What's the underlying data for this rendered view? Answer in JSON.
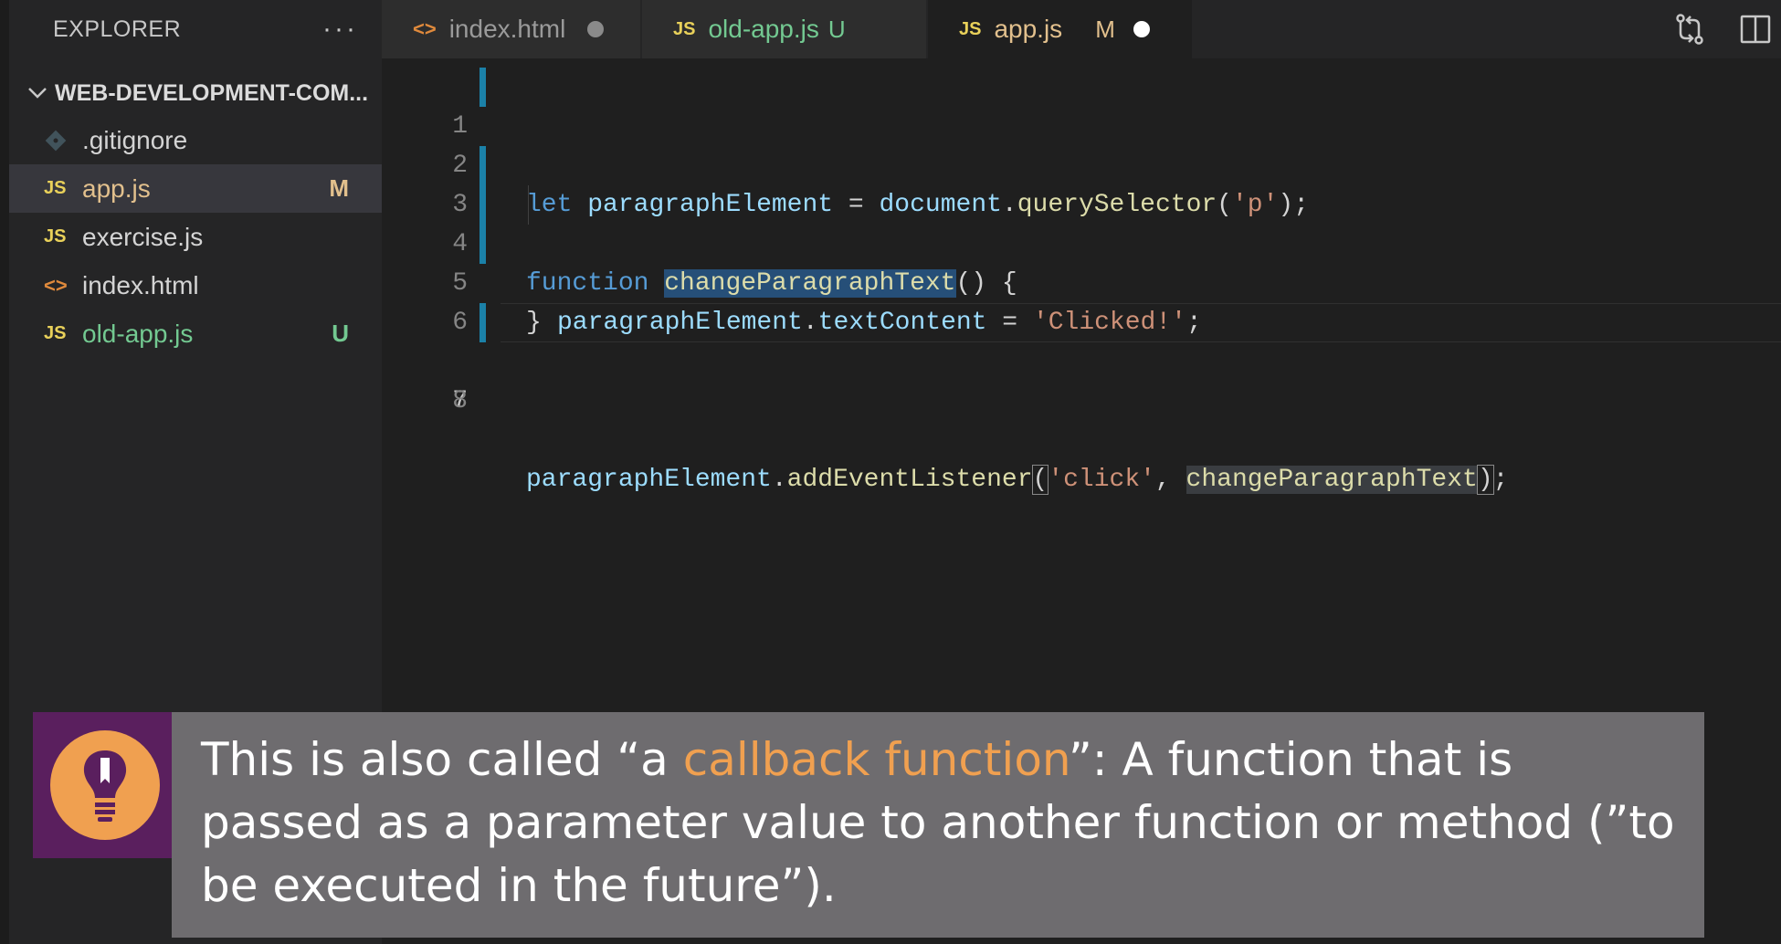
{
  "sidebar": {
    "title": "EXPLORER",
    "more": "···",
    "folder": "WEB-DEVELOPMENT-COM...",
    "files": [
      {
        "name": ".gitignore",
        "icon": "git-icon",
        "badge": ""
      },
      {
        "name": "app.js",
        "icon": "js-icon",
        "badge": "M"
      },
      {
        "name": "exercise.js",
        "icon": "js-icon",
        "badge": ""
      },
      {
        "name": "index.html",
        "icon": "html-icon",
        "badge": ""
      },
      {
        "name": "old-app.js",
        "icon": "js-icon",
        "badge": "U"
      }
    ]
  },
  "tabs": [
    {
      "label": "index.html",
      "icon": "html-icon",
      "badge": ""
    },
    {
      "label": "old-app.js",
      "icon": "js-icon",
      "badge": "U"
    },
    {
      "label": "app.js",
      "icon": "js-icon",
      "badge": "M"
    }
  ],
  "icons": {
    "js": "JS",
    "html": "<>"
  },
  "editor": {
    "line_numbers": [
      "1",
      "2",
      "3",
      "4",
      "5",
      "6",
      "7",
      "8"
    ],
    "line1": {
      "kw": "let",
      "var": "paragraphElement",
      "eq": " = ",
      "obj": "document",
      "dot": ".",
      "fn": "querySelector",
      "open": "(",
      "str": "'p'",
      "close": ");"
    },
    "line3": {
      "kw": "function",
      "fn": "changeParagraphText",
      "rest": "() {"
    },
    "line4": {
      "var": "paragraphElement",
      "dot": ".",
      "prop": "textContent",
      "eq": " = ",
      "str": "'Clicked!'",
      "end": ";"
    },
    "line5": {
      "brace": "}"
    },
    "line7": {
      "var": "paragraphElement",
      "dot": ".",
      "fn": "addEventListener",
      "open": "(",
      "str": "'click'",
      "comma": ", ",
      "arg": "changeParagraphText",
      "close": ")",
      "end": ";"
    }
  },
  "caption": {
    "before": "This is also called “a ",
    "highlight": "callback function",
    "after": "”: A function that is passed as a parameter value to another function or method (”to be executed in the future”).",
    "colors": {
      "highlight": "#f0a050",
      "icon_bg": "#5a1f5e",
      "bulb": "#f0a050"
    }
  }
}
